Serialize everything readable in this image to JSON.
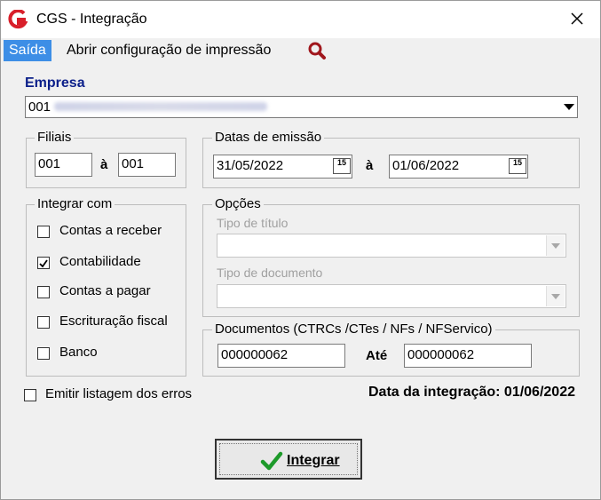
{
  "window": {
    "title": "CGS - Integração",
    "close_label": "✕"
  },
  "menu": {
    "items": [
      "Saída",
      "Abrir configuração de impressão"
    ]
  },
  "empresa": {
    "label": "Empresa",
    "value": "001"
  },
  "filiais": {
    "label": "Filiais",
    "from": "001",
    "sep": "à",
    "to": "001"
  },
  "datas": {
    "label": "Datas de emissão",
    "from": "31/05/2022",
    "sep": "à",
    "to": "01/06/2022",
    "cal_icon": "15"
  },
  "integrar": {
    "label": "Integrar com",
    "items": [
      {
        "label": "Contas a receber",
        "checked": false
      },
      {
        "label": "Contabilidade",
        "checked": true
      },
      {
        "label": "Contas a pagar",
        "checked": false
      },
      {
        "label": "Escrituração fiscal",
        "checked": false
      },
      {
        "label": "Banco",
        "checked": false
      }
    ]
  },
  "opcoes": {
    "label": "Opções",
    "tipo_titulo": "Tipo de título",
    "tipo_documento": "Tipo de documento"
  },
  "documentos": {
    "label": "Documentos (CTRCs /CTes / NFs / NFServico)",
    "from": "000000062",
    "sep": "Até",
    "to": "000000062"
  },
  "emitir": {
    "label": "Emitir listagem dos erros",
    "checked": false
  },
  "data_integracao": "Data da integração: 01/06/2022",
  "integrar_button": "Integrar",
  "colors": {
    "accent": "#3d8ee6",
    "logo": "#d81f2a",
    "search": "#a0171d",
    "check": "#1d9a2a",
    "label_blue": "#0b1f8a"
  }
}
